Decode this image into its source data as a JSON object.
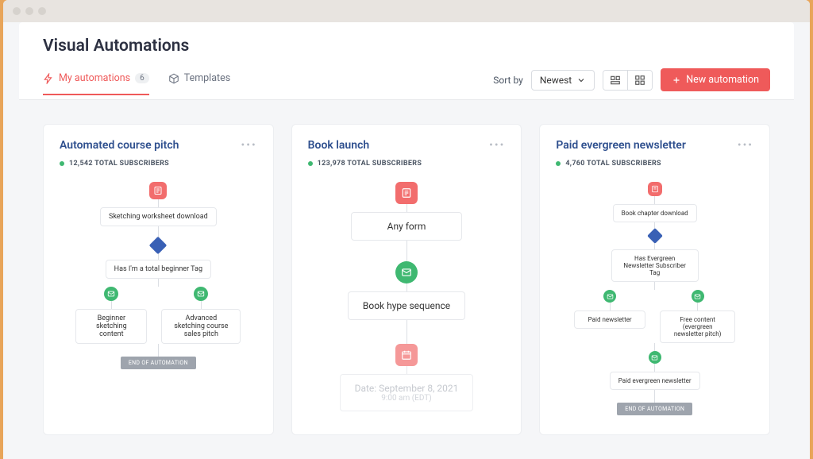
{
  "page": {
    "title": "Visual Automations"
  },
  "tabs": {
    "my_automations": {
      "label": "My automations",
      "count": "6"
    },
    "templates": {
      "label": "Templates"
    }
  },
  "toolbar": {
    "sort_label": "Sort by",
    "sort_value": "Newest",
    "new_button": "New automation"
  },
  "cards": [
    {
      "title": "Automated course pitch",
      "subs": "12,542 TOTAL SUBSCRIBERS",
      "flow": {
        "entry": "Sketching worksheet download",
        "cond": "Has I'm a total beginner Tag",
        "left": "Beginner sketching content",
        "right": "Advanced sketching course sales pitch",
        "end": "END OF AUTOMATION"
      }
    },
    {
      "title": "Book launch",
      "subs": "123,978 TOTAL SUBSCRIBERS",
      "flow": {
        "entry": "Any form",
        "seq": "Book hype sequence",
        "date_label": "Date: September 8, 2021",
        "date_time": "9:00 am (EDT)"
      }
    },
    {
      "title": "Paid evergreen newsletter",
      "subs": "4,760 TOTAL SUBSCRIBERS",
      "flow": {
        "entry": "Book chapter download",
        "cond": "Has Evergreen Newsletter Subscriber Tag",
        "left": "Paid newsletter",
        "right": "Free content (evergreen newsletter pitch)",
        "seq": "Paid evergreen newsletter",
        "end": "END OF AUTOMATION"
      }
    }
  ]
}
